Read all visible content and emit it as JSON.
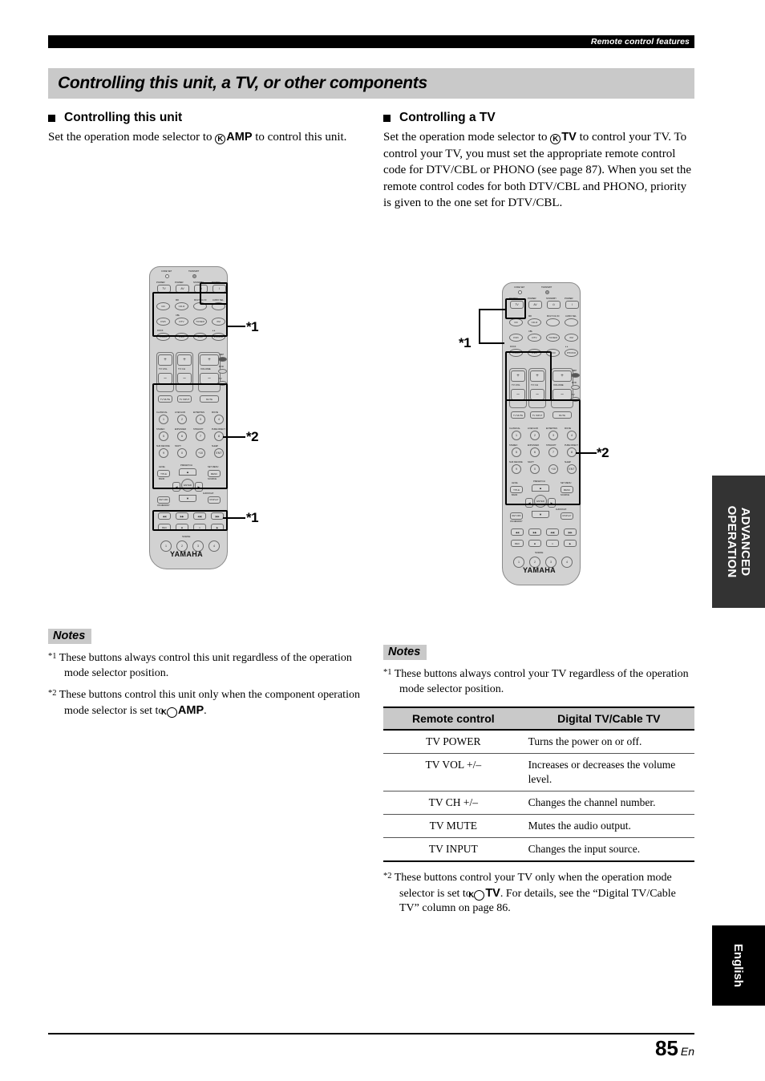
{
  "runhead": {
    "text": "Remote control features"
  },
  "title": "Controlling this unit, a TV, or other components",
  "left": {
    "heading": "Controlling this unit",
    "body_pre": "Set the operation mode selector to ",
    "k": "K",
    "mode": "AMP",
    "body_post": " to control this unit.",
    "notes_label": "Notes",
    "note1_mark": "*1",
    "note1": "These buttons always control this unit regardless of the operation mode selector position.",
    "note2_mark": "*2",
    "note2_pre": "These buttons control this unit only when the component operation mode selector is set to ",
    "note2_mode": "AMP",
    "note2_post": "."
  },
  "right": {
    "heading": "Controlling a TV",
    "body_pre": "Set the operation mode selector to ",
    "k": "K",
    "mode": "TV",
    "body_post": " to control your TV. To control your TV, you must set the appropriate remote control code for DTV/CBL or PHONO (see page 87). When you set the remote control codes for both DTV/CBL and PHONO, priority is given to the one set for DTV/CBL.",
    "notes_label": "Notes",
    "note1_mark": "*1",
    "note1": "These buttons always control your TV regardless of the operation mode selector position.",
    "note2_mark": "*2",
    "note2_pre": "These buttons control your TV only when the operation mode selector is set to ",
    "note2_mode": "TV",
    "note2_post": ". For details, see the “Digital TV/Cable TV” column on page 86."
  },
  "table": {
    "headers": [
      "Remote control",
      "Digital TV/Cable TV"
    ],
    "rows": [
      [
        "TV POWER",
        "Turns the power on or off."
      ],
      [
        "TV VOL +/–",
        "Increases or decreases the volume level."
      ],
      [
        "TV CH +/–",
        "Changes the channel number."
      ],
      [
        "TV MUTE",
        "Mutes the audio output."
      ],
      [
        "TV INPUT",
        "Changes the input source."
      ]
    ]
  },
  "callouts": {
    "left": [
      "*1",
      "*2",
      "*1"
    ],
    "right": [
      "*1",
      "*2"
    ]
  },
  "remote": {
    "brand": "YAMAHA",
    "top_leds": [
      "CODE SET",
      "TRANSMIT"
    ],
    "power_row": [
      {
        "top": "POWER",
        "label": "TV"
      },
      {
        "top": "POWER",
        "label": "AV"
      },
      {
        "top": "STANDBY",
        "label": "⏻"
      },
      {
        "top": "POWER",
        "label": "I"
      }
    ],
    "source_labels_r1": [
      "",
      "MD",
      "MULTI CH IN",
      "AUDIO SEL"
    ],
    "source_r1": [
      "CD",
      "CD-R",
      "",
      ""
    ],
    "source_labels_r2": [
      "",
      "CBL",
      "",
      ""
    ],
    "source_r2": [
      "DVD",
      "DTV",
      "TUNER",
      "XM"
    ],
    "source_labels_r3": [
      "DOCK",
      "",
      "",
      "♦ ♦"
    ],
    "source_r3": [
      "V-AUX",
      "DVR",
      "VCR",
      "PHONO"
    ],
    "vol_group": [
      {
        "label": "TV VOL",
        "plus": "+",
        "minus": "–"
      },
      {
        "label": "TV CH",
        "plus": "+",
        "minus": "–"
      },
      {
        "label": "VOLUME",
        "plus": "+",
        "minus": "–"
      }
    ],
    "mute_row": [
      "TV MUTE",
      "TV INPUT",
      "MUTE"
    ],
    "selector": [
      "AMP",
      "DVD",
      "TV"
    ],
    "dsp_labels_r1": [
      "CLASSICAL",
      "LIVE/CLUB",
      "ENTERTAIN",
      "MOVIE"
    ],
    "dsp_r1": [
      "1",
      "2",
      "3",
      "4"
    ],
    "dsp_labels_r2": [
      "STEREO",
      "ENHANCER",
      "STRAIGHT",
      "PURE DIRECT"
    ],
    "dsp_r2": [
      "5",
      "6",
      "7",
      "8"
    ],
    "dsp_labels_r3": [
      "SUR.DECODE",
      "NIGHT",
      "",
      "SLEEP"
    ],
    "dsp_r3": [
      "9",
      "0",
      "+10",
      "ENT"
    ],
    "nav_left": {
      "top": "LEVEL",
      "mid": "TITLE",
      "bot": "BAND"
    },
    "nav_right": {
      "top": "SET MENU",
      "mid": "MENU",
      "bot": "SOURCE"
    },
    "nav_preset": "PRESET/CH",
    "nav_enter": "ENTER",
    "nav_audio": "AUDIO/CAT.",
    "nav_return": "RETURN",
    "nav_memory": "ON MEMORY",
    "nav_display": "DISPLAY",
    "transport": [
      "◀◀",
      "▶▶",
      "◀◀|",
      "|▶▶"
    ],
    "transport2": [
      "REC",
      "■",
      "⏸",
      "▶"
    ],
    "scene_label": "SCENE",
    "scene": [
      "1",
      "2",
      "3",
      "4"
    ]
  },
  "tabs": {
    "advanced": "ADVANCED\nOPERATION",
    "language": "English"
  },
  "footer": {
    "page": "85",
    "suffix": "En"
  }
}
